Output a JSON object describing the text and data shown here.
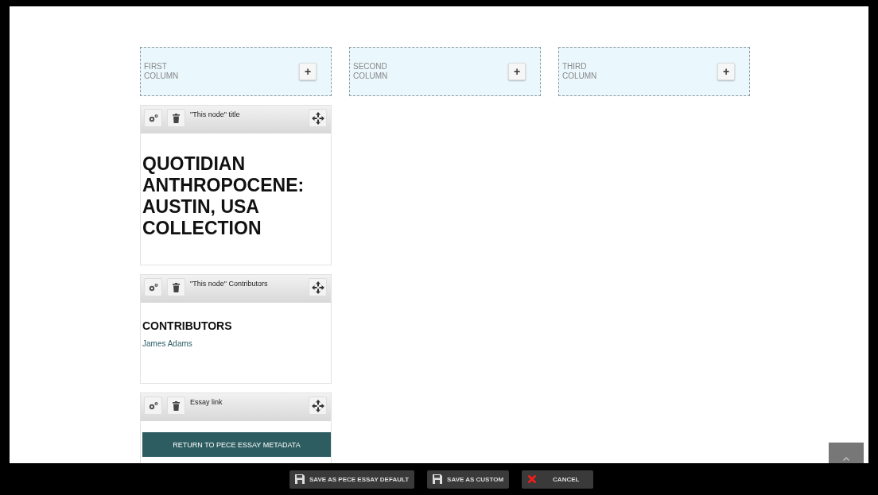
{
  "columns": [
    {
      "label": "FIRST COLUMN",
      "add": "+"
    },
    {
      "label": "SECOND COLUMN",
      "add": "+"
    },
    {
      "label": "THIRD COLUMN",
      "add": "+"
    }
  ],
  "panes": [
    {
      "kind": "title",
      "header": "\"This node\" title",
      "heading": "QUOTIDIAN ANTHROPOCENE: AUSTIN, USA COLLECTION"
    },
    {
      "kind": "contributors",
      "header": "\"This node\" Contributors",
      "heading": "CONTRIBUTORS",
      "link": "James Adams"
    },
    {
      "kind": "button",
      "header": "Essay link",
      "button": "RETURN TO PECE ESSAY METADATA"
    }
  ],
  "footer_buttons": [
    {
      "kind": "save",
      "label": "SAVE AS PECE ESSAY DEFAULT"
    },
    {
      "kind": "save",
      "label": "SAVE AS CUSTOM"
    },
    {
      "kind": "cancel",
      "label": "CANCEL"
    }
  ]
}
